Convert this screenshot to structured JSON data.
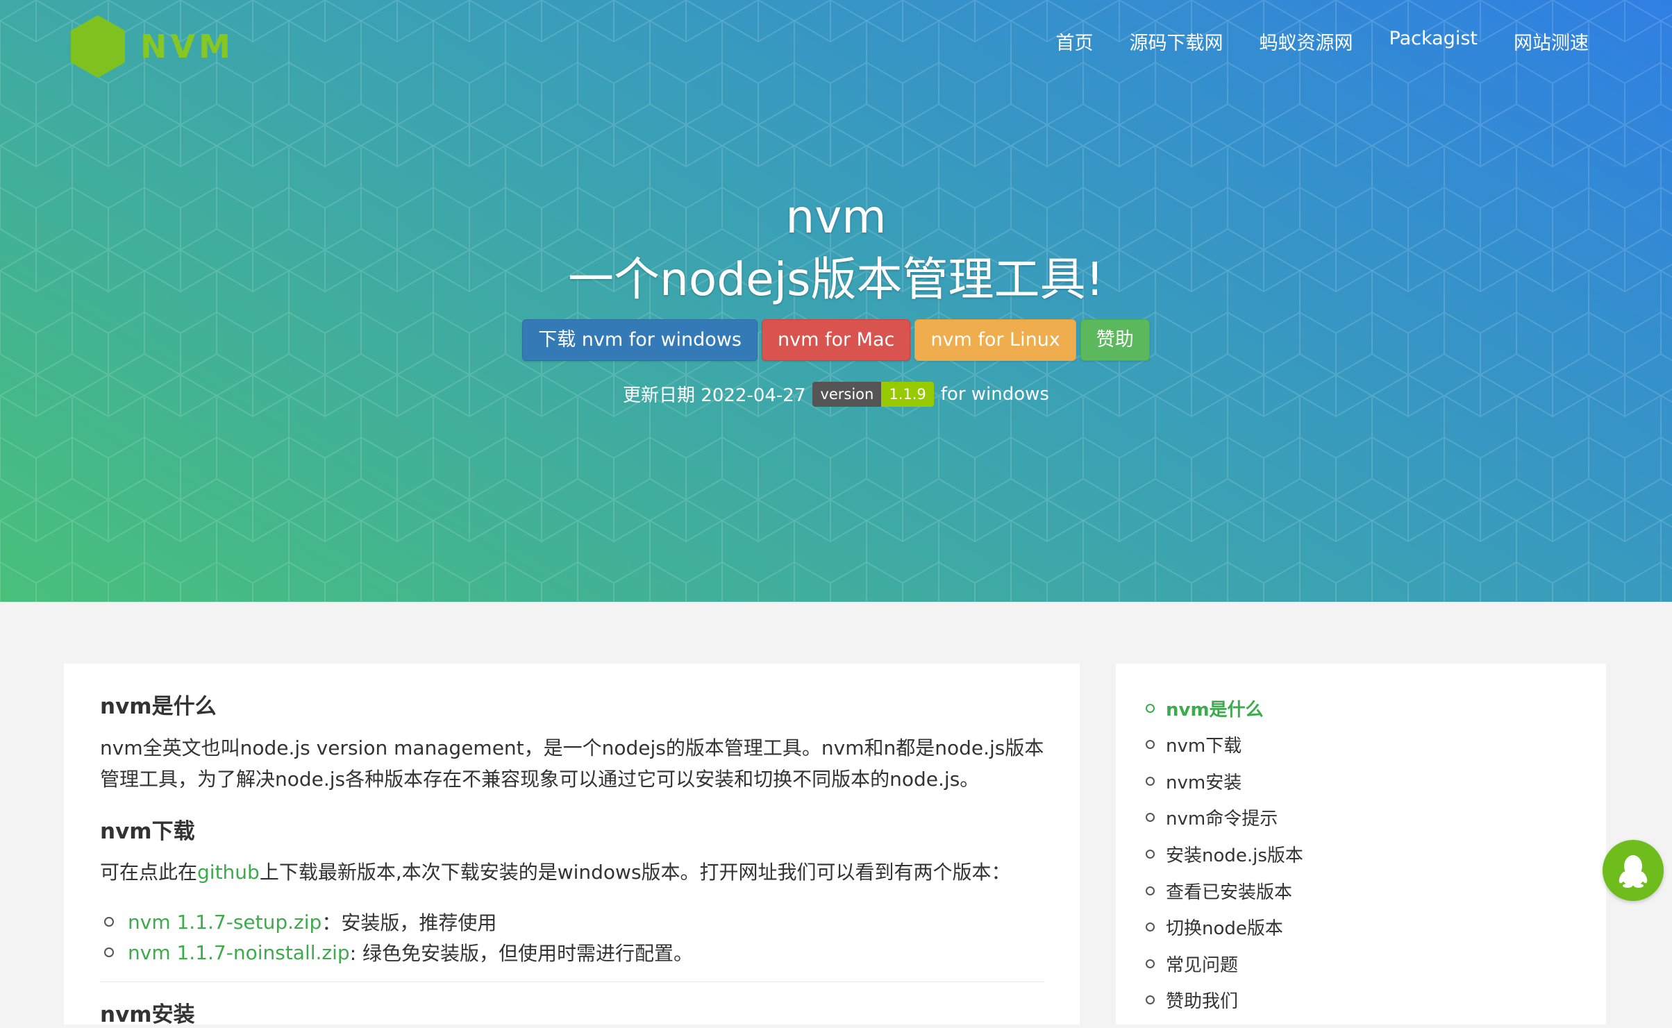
{
  "header": {
    "logo_text": "NVM",
    "nav": [
      "首页",
      "源码下载网",
      "蚂蚁资源网",
      "Packagist",
      "网站测速"
    ]
  },
  "hero": {
    "title": "nvm",
    "subtitle": "一个nodejs版本管理工具!",
    "buttons": [
      "下载 nvm for windows",
      "nvm for Mac",
      "nvm for Linux",
      "赞助"
    ],
    "update_label": "更新日期 2022-04-27",
    "badge_left": "version",
    "badge_right": "1.1.9",
    "update_suffix": "for windows"
  },
  "article": {
    "section1_title": "nvm是什么",
    "section1_text": "nvm全英文也叫node.js version management，是一个nodejs的版本管理工具。nvm和n都是node.js版本管理工具，为了解决node.js各种版本存在不兼容现象可以通过它可以安装和切换不同版本的node.js。",
    "section2_title": "nvm下载",
    "section2_text_before": "可在点此在",
    "section2_link": "github",
    "section2_text_after": "上下载最新版本,本次下载安装的是windows版本。打开网址我们可以看到有两个版本：",
    "downloads": [
      {
        "link": "nvm 1.1.7-setup.zip",
        "desc": "：安装版，推荐使用"
      },
      {
        "link": "nvm 1.1.7-noinstall.zip",
        "desc": ": 绿色免安装版，但使用时需进行配置。"
      }
    ],
    "section3_title": "nvm安装"
  },
  "toc": {
    "items": [
      "nvm是什么",
      "nvm下载",
      "nvm安装",
      "nvm命令提示",
      "安装node.js版本",
      "查看已安装版本",
      "切换node版本",
      "常见问题",
      "赞助我们"
    ],
    "active_index": 0
  },
  "colors": {
    "accent_green": "#3cab4b",
    "logo_green": "#86c722",
    "btn_blue": "#337ab7",
    "btn_red": "#d9534f",
    "btn_orange": "#f0ad4e",
    "btn_green": "#5cb85c",
    "qq_green": "#6fbd1c"
  },
  "icons": {
    "logo": "hexagon-icon",
    "floating": "qq-penguin-icon"
  }
}
